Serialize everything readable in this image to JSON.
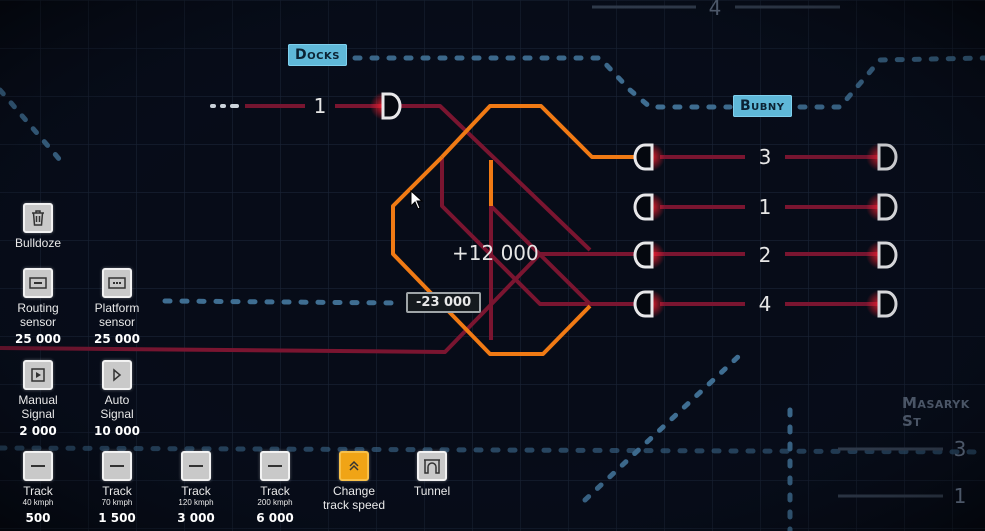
{
  "stations": {
    "docks": {
      "name": "Docks",
      "platform": "1"
    },
    "bubny": {
      "name": "Bubny",
      "platforms": [
        "3",
        "1",
        "2",
        "4"
      ]
    },
    "masaryk": {
      "name": "Masaryk St",
      "platforms": [
        "3",
        "1"
      ]
    },
    "top_offscreen": {
      "platform": "4"
    }
  },
  "costs": {
    "gain": "+12 000",
    "spend": "-23 000"
  },
  "toolbar": {
    "bulldoze": {
      "label": "Bulldoze",
      "icon": "trash-icon"
    },
    "routing_sensor": {
      "label1": "Routing",
      "label2": "sensor",
      "price": "25 000",
      "icon": "routing-sensor-icon"
    },
    "platform_sensor": {
      "label1": "Platform",
      "label2": "sensor",
      "price": "25 000",
      "icon": "platform-sensor-icon"
    },
    "manual_signal": {
      "label1": "Manual",
      "label2": "Signal",
      "price": "2 000",
      "icon": "manual-signal-icon"
    },
    "auto_signal": {
      "label1": "Auto",
      "label2": "Signal",
      "price": "10 000",
      "icon": "auto-signal-icon"
    },
    "tracks": [
      {
        "label": "Track",
        "speed": "40 kmph",
        "price": "500"
      },
      {
        "label": "Track",
        "speed": "70 kmph",
        "price": "1 500"
      },
      {
        "label": "Track",
        "speed": "120 kmph",
        "price": "3 000"
      },
      {
        "label": "Track",
        "speed": "200 kmph",
        "price": "6 000"
      }
    ],
    "change_speed": {
      "label1": "Change",
      "label2": "track speed",
      "active": true,
      "icon": "double-chevron-up-icon"
    },
    "tunnel": {
      "label": "Tunnel",
      "icon": "tunnel-icon"
    }
  },
  "colors": {
    "background": "#070c18",
    "grid": "#1a2436",
    "track_existing": "#7a1530",
    "track_new": "#f07a14",
    "station_line": "#3f6e92",
    "signal_glow": "#ff2030",
    "active_tool": "#f0a416"
  }
}
